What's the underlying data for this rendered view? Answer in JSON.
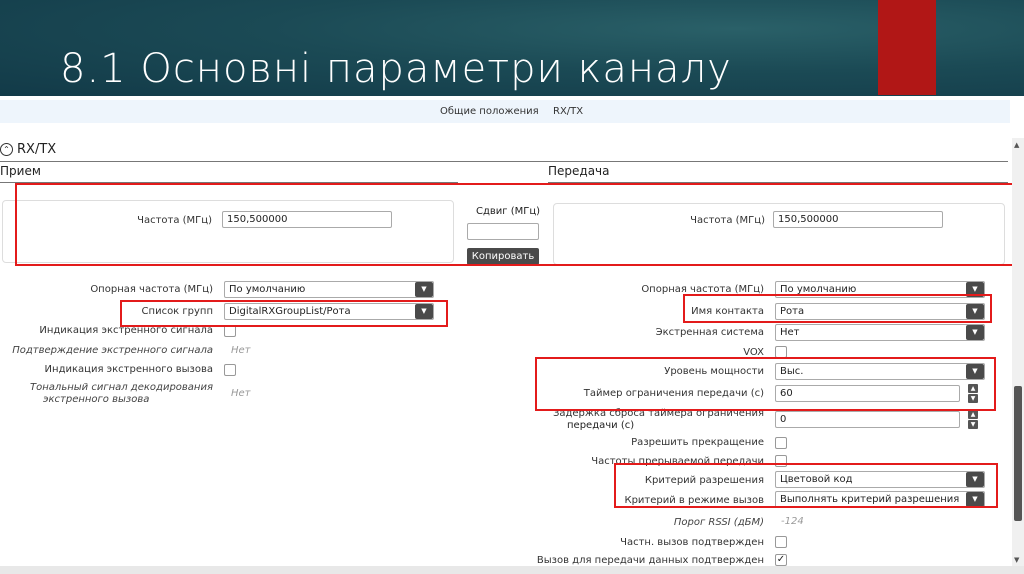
{
  "slide_title": "8.1 Основні параметри каналу",
  "tabs": [
    "Общие положения",
    "RX/TX"
  ],
  "section": {
    "title": "RX/TX",
    "rx_title": "Прием",
    "tx_title": "Передача"
  },
  "rx": {
    "freq_label": "Частота (МГц)",
    "freq_value": "150,500000",
    "ref_label": "Опорная частота (МГц)",
    "ref_value": "По умолчанию",
    "group_label": "Список групп",
    "group_value": "DigitalRXGroupList/Рота",
    "emerg_ind_label": "Индикация экстренного сигнала",
    "emerg_ack_label": "Подтверждение экстренного сигнала",
    "emerg_ack_value": "Нет",
    "emerg_call_label": "Индикация экстренного вызова",
    "tone_label_1": "Тональный сигнал декодирования",
    "tone_label_2": "экстренного вызова",
    "tone_value": "Нет"
  },
  "offset": {
    "label": "Сдвиг (МГц)",
    "value": "",
    "copy_button": "Копировать"
  },
  "tx": {
    "freq_label": "Частота (МГц)",
    "freq_value": "150,500000",
    "ref_label": "Опорная частота (МГц)",
    "ref_value": "По умолчанию",
    "contact_label": "Имя контакта",
    "contact_value": "Рота",
    "emerg_sys_label": "Экстренная система",
    "emerg_sys_value": "Нет",
    "vox_label": "VOX",
    "power_label": "Уровень мощности",
    "power_value": "Выс.",
    "tot_label": "Таймер ограничения передачи (с)",
    "tot_value": "60",
    "tot_delay_label_1": "Задержка сброса таймера ограничения",
    "tot_delay_label_2": "передачи (с)",
    "tot_delay_value": "0",
    "allow_interrupt_label": "Разрешить прекращение",
    "interrupt_freq_label": "Частоты прерываемой передачи",
    "admit_label": "Критерий разрешения",
    "admit_value": "Цветовой код",
    "call_admit_label": "Критерий в режиме вызов",
    "call_admit_value": "Выполнять критерий разрешения",
    "rssi_label": "Порог RSSI (дБМ)",
    "rssi_value": "-124",
    "private_ack_label": "Частн. вызов подтвержден",
    "data_ack_label": "Вызов для передачи данных подтвержден",
    "data_ack_checked": true
  }
}
